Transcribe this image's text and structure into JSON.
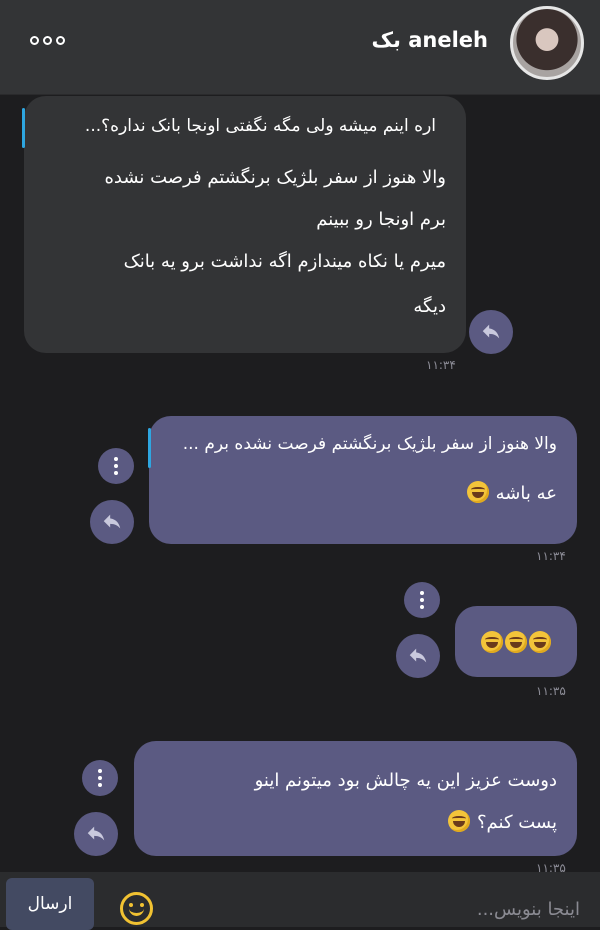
{
  "header": {
    "contact_name": "aneleh بک"
  },
  "messages": [
    {
      "direction": "incoming",
      "quote": "اره اینم میشه ولی مگه نگفتی اونجا بانک نداره؟...",
      "lines": [
        "والا هنوز از سفر بلژیک برنگشتم فرصت نشده",
        "برم اونجا رو ببینم",
        "میرم یا نکاه میندازم اگه نداشت برو یه بانک",
        "دیگه"
      ],
      "time": "۱۱:۳۴"
    },
    {
      "direction": "outgoing",
      "quote": "والا هنوز از سفر بلژیک برنگشتم فرصت نشده برم ...",
      "lines": [
        "عه باشه"
      ],
      "time": "۱۱:۳۴"
    },
    {
      "direction": "outgoing",
      "lines": [
        ""
      ],
      "time": "۱۱:۳۵"
    },
    {
      "direction": "outgoing",
      "lines": [
        "دوست عزیز این یه چالش بود میتونم اینو",
        "پست کنم؟"
      ],
      "time": "۱۱:۳۵"
    }
  ],
  "composer": {
    "send_label": "ارسال",
    "placeholder": "اینجا بنویس...",
    "emoji_icon": "smiley-icon"
  },
  "colors": {
    "outgoing_bubble": "#5b5a82",
    "incoming_bubble": "#333436",
    "quote_bar": "#2ea6e0",
    "background": "#1d1d1f"
  }
}
